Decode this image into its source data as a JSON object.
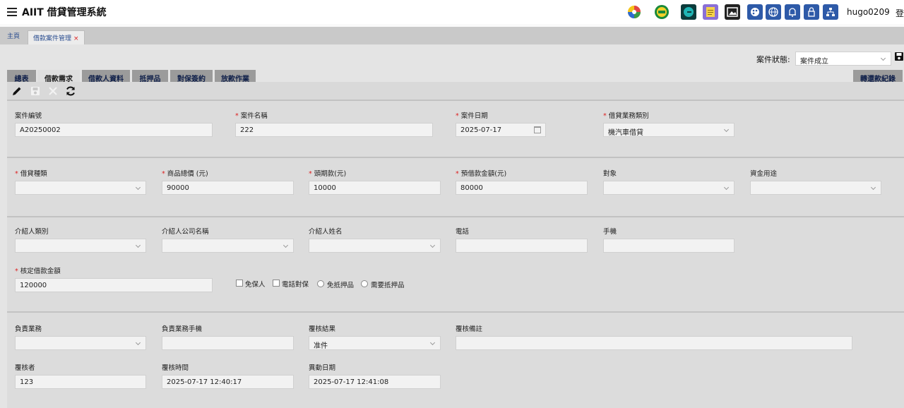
{
  "app": {
    "title": "AIIT 借貸管理系統",
    "username": "hugo0209",
    "logout_label": "登"
  },
  "header_icons": [
    {
      "name": "colorful-logo-icon",
      "color": "#e04646"
    },
    {
      "name": "globe-logo-icon",
      "color": "#1a8a3a"
    },
    {
      "name": "e-app-icon",
      "color": "#0d7a7a"
    },
    {
      "name": "notepad-icon",
      "color": "#8a6fd6"
    },
    {
      "name": "image-board-icon",
      "color": "#222222"
    },
    {
      "name": "palette-icon",
      "color": "#2e5aa8"
    },
    {
      "name": "language-globe-icon",
      "color": "#2e5aa8"
    },
    {
      "name": "bell-icon",
      "color": "#2e5aa8"
    },
    {
      "name": "lock-icon",
      "color": "#2e5aa8"
    },
    {
      "name": "org-chart-icon",
      "color": "#2e5aa8"
    }
  ],
  "top_tabs": [
    {
      "label": "主頁"
    },
    {
      "label": "借款案件管理",
      "close": "×"
    }
  ],
  "status": {
    "label": "案件狀態:",
    "value": "案件成立"
  },
  "section_tabs": [
    "總表",
    "借款需求",
    "借款人資料",
    "抵押品",
    "對保簽約",
    "放款作業"
  ],
  "transfer_label": "轉還款紀錄",
  "form": {
    "case_no": {
      "label": "案件編號",
      "value": "A20250002"
    },
    "case_name": {
      "label": "案件名稱",
      "value": "222"
    },
    "case_date": {
      "label": "案件日期",
      "value": "2025-07-17"
    },
    "loan_biz_type": {
      "label": "借貸業務類別",
      "value": "機汽車借貸"
    },
    "loan_type": {
      "label": "借貸種類",
      "value": ""
    },
    "product_total": {
      "label": "商品總價 (元)",
      "value": "90000"
    },
    "down_payment": {
      "label": "頭期款(元)",
      "value": "10000"
    },
    "expected_amount": {
      "label": "預借款金額(元)",
      "value": "80000"
    },
    "target": {
      "label": "對象",
      "value": ""
    },
    "fund_usage": {
      "label": "資金用途",
      "value": ""
    },
    "referrer_type": {
      "label": "介紹人類別",
      "value": ""
    },
    "referrer_company": {
      "label": "介紹人公司名稱",
      "value": ""
    },
    "referrer_name": {
      "label": "介紹人姓名",
      "value": ""
    },
    "phone": {
      "label": "電話",
      "value": ""
    },
    "mobile": {
      "label": "手機",
      "value": ""
    },
    "approved_amount": {
      "label": "核定借款金額",
      "value": "120000"
    },
    "options": {
      "no_guarantor": "免保人",
      "phone_check": "電話對保",
      "no_collateral": "免抵押品",
      "need_collateral": "需要抵押品"
    },
    "sales": {
      "label": "負責業務",
      "value": ""
    },
    "sales_mobile": {
      "label": "負責業務手機",
      "value": ""
    },
    "review_result": {
      "label": "覆核結果",
      "value": "准件"
    },
    "review_note": {
      "label": "覆核備註",
      "value": ""
    },
    "reviewer": {
      "label": "覆核者",
      "value": "123"
    },
    "review_time": {
      "label": "覆核時間",
      "value": "2025-07-17 12:40:17"
    },
    "change_date": {
      "label": "異動日期",
      "value": "2025-07-17 12:41:08"
    }
  }
}
